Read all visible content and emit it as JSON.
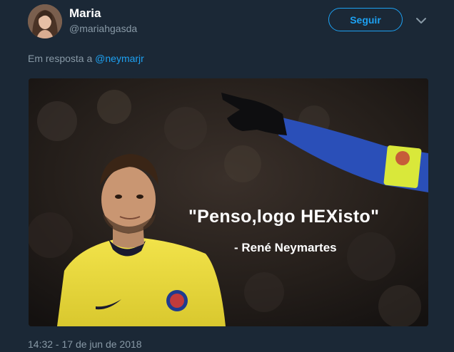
{
  "tweet": {
    "author": {
      "name": "Maria",
      "handle": "@mariahgasda"
    },
    "follow_label": "Seguir",
    "reply": {
      "prefix": "Em resposta a",
      "mention": "@neymarjr"
    },
    "media": {
      "quote": "\"Penso,logo HEXisto\"",
      "attribution": "- René Neymartes"
    },
    "timestamp": "14:32 - 17 de jun de 2018"
  },
  "icons": {
    "avatar": "user-avatar-photo",
    "menu": "chevron-down-icon"
  },
  "colors": {
    "background": "#1b2836",
    "accent": "#1da1f2",
    "secondary_text": "#8899a6"
  }
}
